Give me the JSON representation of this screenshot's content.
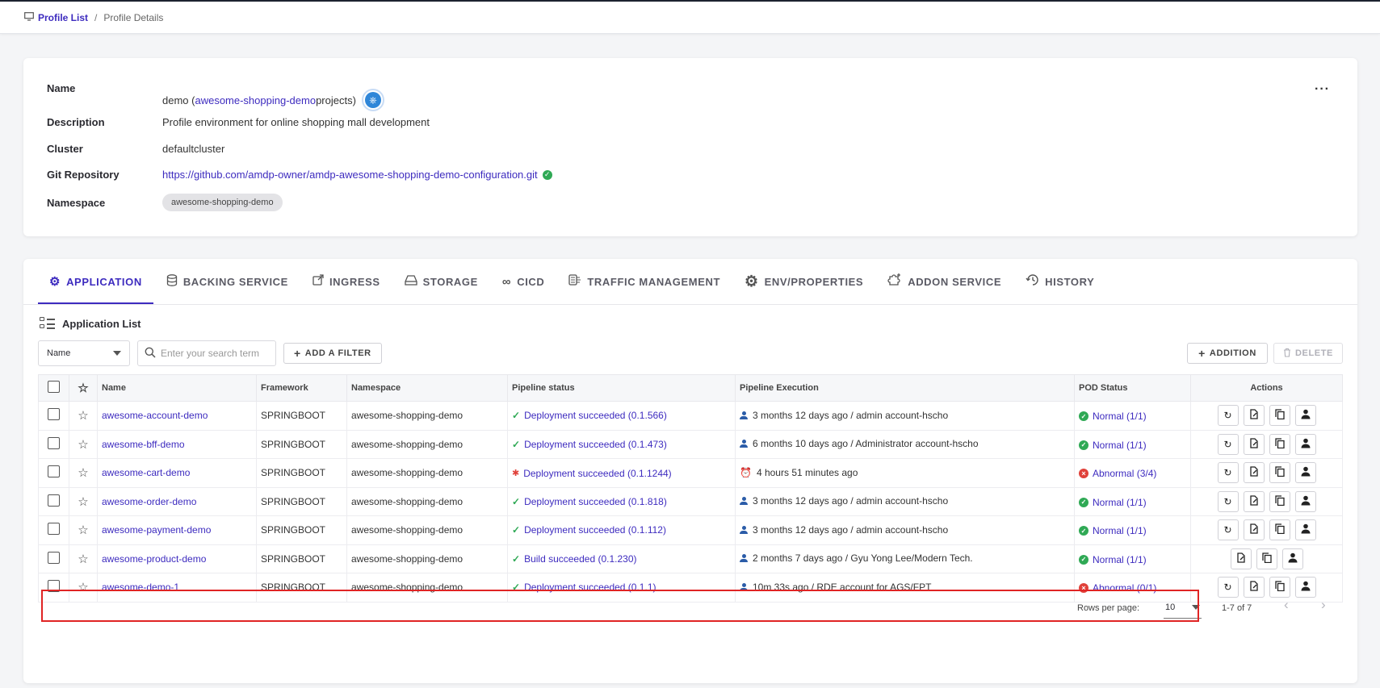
{
  "breadcrumb": {
    "root": "Profile List",
    "separator": "/",
    "current": "Profile Details"
  },
  "profile": {
    "name_label": "Name",
    "name_value_prefix": "demo (",
    "name_link": "awesome-shopping-demo",
    "name_value_suffix": "projects)",
    "description_label": "Description",
    "description_value": "Profile environment for online shopping mall development",
    "cluster_label": "Cluster",
    "cluster_value": "defaultcluster",
    "git_label": "Git Repository",
    "git_value": "https://github.com/amdp-owner/amdp-awesome-shopping-demo-configuration.git",
    "namespace_label": "Namespace",
    "namespace_value": "awesome-shopping-demo",
    "more": "···"
  },
  "tabs": [
    {
      "label": "APPLICATION",
      "icon": "gear-icon",
      "active": true
    },
    {
      "label": "BACKING SERVICE",
      "icon": "database-icon"
    },
    {
      "label": "INGRESS",
      "icon": "external-link-icon"
    },
    {
      "label": "STORAGE",
      "icon": "drive-icon"
    },
    {
      "label": "CICD",
      "icon": "infinity-icon"
    },
    {
      "label": "TRAFFIC MANAGEMENT",
      "icon": "traffic-icon"
    },
    {
      "label": "ENV/PROPERTIES",
      "icon": "settings-icon"
    },
    {
      "label": "ADDON SERVICE",
      "icon": "puzzle-icon"
    },
    {
      "label": "HISTORY",
      "icon": "history-icon"
    }
  ],
  "list": {
    "title": "Application List",
    "filter_select": "Name",
    "search_placeholder": "Enter your search term",
    "add_filter": "ADD A FILTER",
    "add": "ADDITION",
    "delete": "DELETE"
  },
  "table": {
    "headers": {
      "name": "Name",
      "framework": "Framework",
      "namespace": "Namespace",
      "pipeline": "Pipeline status",
      "execution": "Pipeline Execution",
      "pod": "POD Status",
      "actions": "Actions"
    },
    "rows": [
      {
        "name": "awesome-account-demo",
        "framework": "SPRINGBOOT",
        "namespace": "awesome-shopping-demo",
        "pipeline": "Deployment succeeded (0.1.566)",
        "execution": "3 months 12 days ago / admin account-hscho",
        "pod": "Normal (1/1)"
      },
      {
        "name": "awesome-bff-demo",
        "framework": "SPRINGBOOT",
        "namespace": "awesome-shopping-demo",
        "pipeline": "Deployment succeeded (0.1.473)",
        "execution": "6 months 10 days ago / Administrator account-hscho",
        "pod": "Normal (1/1)"
      },
      {
        "name": "awesome-cart-demo",
        "framework": "SPRINGBOOT",
        "namespace": "awesome-shopping-demo",
        "pipeline": "Deployment succeeded (0.1.1244)",
        "execution": "4 hours 51 minutes ago",
        "pod": "Abnormal (3/4)"
      },
      {
        "name": "awesome-order-demo",
        "framework": "SPRINGBOOT",
        "namespace": "awesome-shopping-demo",
        "pipeline": "Deployment succeeded (0.1.818)",
        "execution": "3 months 12 days ago / admin account-hscho",
        "pod": "Normal (1/1)"
      },
      {
        "name": "awesome-payment-demo",
        "framework": "SPRINGBOOT",
        "namespace": "awesome-shopping-demo",
        "pipeline": "Deployment succeeded (0.1.112)",
        "execution": "3 months 12 days ago / admin account-hscho",
        "pod": "Normal (1/1)"
      },
      {
        "name": "awesome-product-demo",
        "framework": "SPRINGBOOT",
        "namespace": "awesome-shopping-demo",
        "pipeline": "Build succeeded (0.1.230)",
        "execution": "2 months 7 days ago / Gyu Yong Lee/Modern Tech.",
        "pod": "Normal (1/1)"
      },
      {
        "name": "awesome-demo-1",
        "framework": "SPRINGBOOT",
        "namespace": "awesome-shopping-demo",
        "pipeline": "Deployment succeeded (0.1.1)",
        "execution": "10m 33s ago / RDE account for AGS/FPT",
        "pod": "Abnormal (0/1)"
      }
    ]
  },
  "pagination": {
    "rows_label": "Rows per page:",
    "rows_value": "10",
    "range": "1-7 of 7"
  },
  "colors": {
    "accent": "#3d2bbf",
    "success": "#2fa955",
    "error": "#e0413a",
    "highlight": "#e02424"
  }
}
